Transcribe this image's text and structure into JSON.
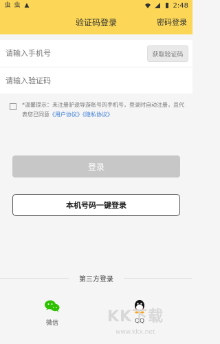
{
  "status_bar": {
    "left_icons": [
      "sim-icon",
      "sim-icon",
      "notification-icon"
    ],
    "left_text": [
      "虫",
      "虫",
      "▲"
    ],
    "time": "2:48"
  },
  "header": {
    "title": "验证码登录",
    "right_link": "密码登录"
  },
  "form": {
    "phone_placeholder": "请输入手机号",
    "get_code_label": "获取验证码",
    "code_placeholder": "请输入验证码"
  },
  "agreement": {
    "text": "*温馨提示：未注册驴途导游账号的手机号，登录时自动注册，且代表您已同意",
    "user_agreement": "《用户协议》",
    "privacy_policy": "《隐私协议》"
  },
  "buttons": {
    "login": "登录",
    "one_key_login": "本机号码一键登录"
  },
  "third_party": {
    "title": "第三方登录",
    "wechat": "微信",
    "qq": "QQ"
  },
  "watermark": {
    "brand": "KK下载",
    "site": "www.kkx.net"
  },
  "colors": {
    "header_bg": "#fcd757",
    "link": "#3b7dd8",
    "disabled_button": "#c7c7c7",
    "wechat_green": "#2dc100"
  }
}
